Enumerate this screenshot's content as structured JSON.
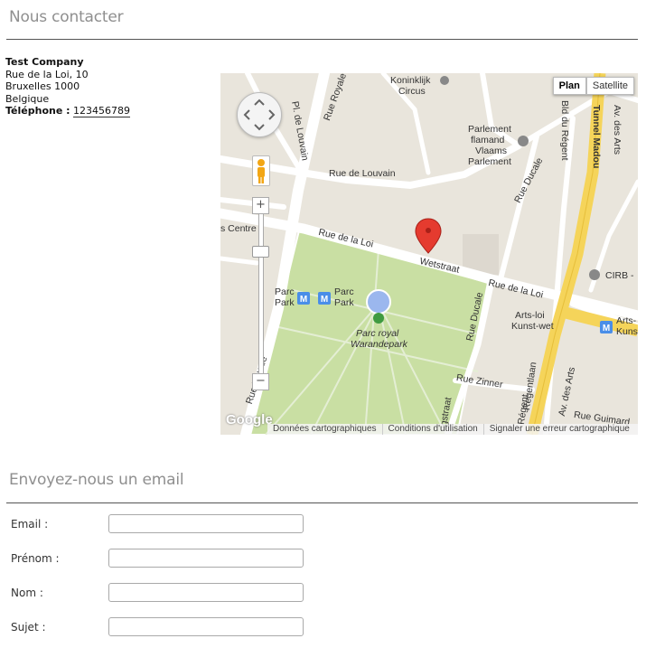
{
  "contact": {
    "title": "Nous contacter",
    "company": "Test Company",
    "street": "Rue de la Loi, 10",
    "city": "Bruxelles 1000",
    "country": "Belgique",
    "phone_label": "Téléphone :",
    "phone_value": "123456789"
  },
  "map": {
    "type_buttons": [
      "Plan",
      "Satellite"
    ],
    "active_type": "Plan",
    "labels": {
      "koninklijk": "Koninklijk",
      "circus": "Circus",
      "parlement": "Parlement",
      "flamand": "flamand",
      "vlaams": "Vlaams",
      "parlement2": "Parlement",
      "rue_royale": "Rue Royale",
      "pl_de_louvain": "Pl. de Louvain",
      "rue_de_louvain": "Rue de Louvain",
      "rue_ducale": "Rue Ducale",
      "rue_ducale2": "Rue Ducale",
      "bld_du_regent": "Bld du Régent",
      "tunnel_madou": "Tunnel Madou",
      "av_des_arts": "Av. des Arts",
      "rue_de_la_loi": "Rue de la Loi",
      "wetstraat": "Wetstraat",
      "rue_de_la_loi2": "Rue de la Loi",
      "s_centre": "s Centre",
      "parc_park": "Parc\nPark",
      "parc_royal": "Parc royal",
      "warandepark": "Warandepark",
      "cirb": "CIRB -",
      "arts_loi": "Arts-loi",
      "kunst_wet": "Kunst-wet",
      "arts_right": "Arts-",
      "kuns_right": "Kuns",
      "rue_zinner": "Rue Zinner",
      "rue_guimard": "Rue Guimard",
      "regentlaan": "Regentlaan",
      "av_des_arts2": "Av. des Arts",
      "rue_royale2": "Rue Royale",
      "ogstraat": "ogstraat",
      "regent_bottom": "Régent"
    },
    "zoom_in": "+",
    "zoom_out": "−",
    "logo": "Google",
    "footer": [
      "Données cartographiques",
      "Conditions d'utilisation",
      "Signaler une erreur cartographique"
    ]
  },
  "email_form": {
    "title": "Envoyez-nous un email",
    "fields": [
      {
        "label": "Email :",
        "value": ""
      },
      {
        "label": "Prénom :",
        "value": ""
      },
      {
        "label": "Nom :",
        "value": ""
      },
      {
        "label": "Sujet :",
        "value": ""
      }
    ]
  }
}
